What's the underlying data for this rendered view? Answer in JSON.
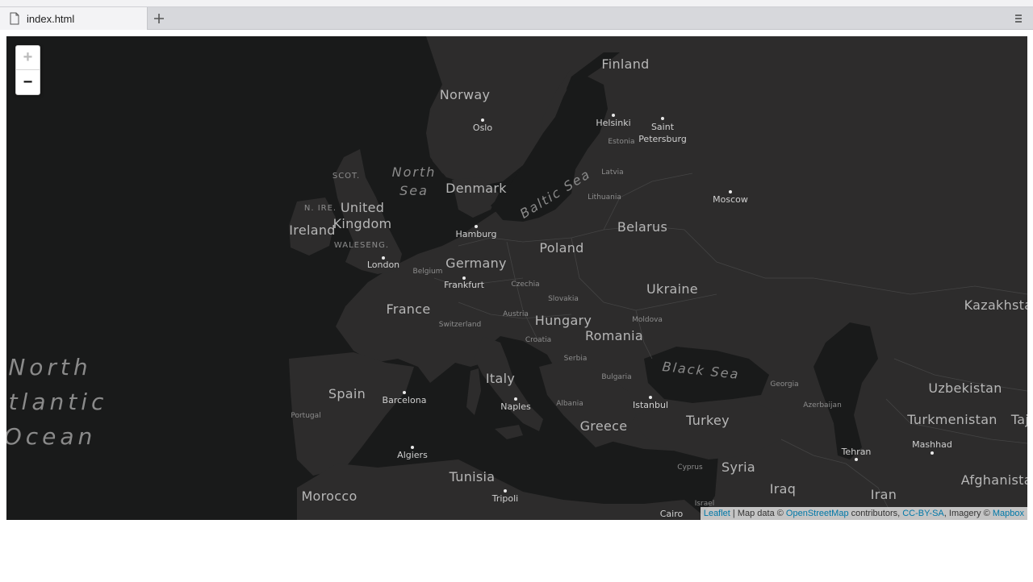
{
  "browser": {
    "tab_title": "index.html",
    "new_tab_icon": "plus-icon",
    "menu_icon": "hamburger-icon"
  },
  "map": {
    "zoom_in_label": "+",
    "zoom_out_label": "−",
    "colors": {
      "water": "#191a1a",
      "land": "#2d2c2c",
      "border": "#444444",
      "label": "#b7b7b7",
      "sea_label": "#8a8a8a",
      "accent_link": "#0078a8"
    },
    "country_labels": [
      {
        "id": "finland",
        "text": "Finland"
      },
      {
        "id": "norway",
        "text": "Norway"
      },
      {
        "id": "denmark",
        "text": "Denmark"
      },
      {
        "id": "united1",
        "text": "United"
      },
      {
        "id": "kingdom",
        "text": "Kingdom"
      },
      {
        "id": "ireland",
        "text": "Ireland"
      },
      {
        "id": "germany",
        "text": "Germany"
      },
      {
        "id": "poland",
        "text": "Poland"
      },
      {
        "id": "belarus",
        "text": "Belarus"
      },
      {
        "id": "ukraine",
        "text": "Ukraine"
      },
      {
        "id": "france",
        "text": "France"
      },
      {
        "id": "hungary",
        "text": "Hungary"
      },
      {
        "id": "romania",
        "text": "Romania"
      },
      {
        "id": "spain",
        "text": "Spain"
      },
      {
        "id": "italy",
        "text": "Italy"
      },
      {
        "id": "greece",
        "text": "Greece"
      },
      {
        "id": "turkey",
        "text": "Turkey"
      },
      {
        "id": "tunisia",
        "text": "Tunisia"
      },
      {
        "id": "morocco",
        "text": "Morocco"
      },
      {
        "id": "syria",
        "text": "Syria"
      },
      {
        "id": "iraq",
        "text": "Iraq"
      },
      {
        "id": "iran",
        "text": "Iran"
      },
      {
        "id": "kazakhstan",
        "text": "Kazakhsta"
      },
      {
        "id": "uzbekistan",
        "text": "Uzbekistan"
      },
      {
        "id": "turkmenistan",
        "text": "Turkmenistan"
      },
      {
        "id": "afghanistan",
        "text": "Afghanistan"
      },
      {
        "id": "taj",
        "text": "Taj"
      }
    ],
    "small_labels": [
      {
        "id": "scot",
        "text": "SCOT."
      },
      {
        "id": "nire",
        "text": "N. IRE."
      },
      {
        "id": "waleseng",
        "text": "WALESENG."
      },
      {
        "id": "estonia",
        "text": "Estonia"
      },
      {
        "id": "latvia",
        "text": "Latvia"
      },
      {
        "id": "lithuania",
        "text": "Lithuania"
      },
      {
        "id": "belgium",
        "text": "Belgium"
      },
      {
        "id": "czechia",
        "text": "Czechia"
      },
      {
        "id": "slovakia",
        "text": "Slovakia"
      },
      {
        "id": "austria",
        "text": "Austria"
      },
      {
        "id": "switzerland",
        "text": "Switzerland"
      },
      {
        "id": "croatia",
        "text": "Croatia"
      },
      {
        "id": "serbia",
        "text": "Serbia"
      },
      {
        "id": "moldova",
        "text": "Moldova"
      },
      {
        "id": "bulgaria",
        "text": "Bulgaria"
      },
      {
        "id": "albania",
        "text": "Albania"
      },
      {
        "id": "portugal",
        "text": "Portugal"
      },
      {
        "id": "georgia",
        "text": "Georgia"
      },
      {
        "id": "azerbaijan",
        "text": "Azerbaijan"
      },
      {
        "id": "cyprus",
        "text": "Cyprus"
      },
      {
        "id": "israel",
        "text": "Israel"
      }
    ],
    "sea_labels": [
      {
        "id": "north_sea_1",
        "text": "North"
      },
      {
        "id": "north_sea_2",
        "text": "Sea"
      },
      {
        "id": "baltic_sea",
        "text": "Baltic Sea"
      },
      {
        "id": "black_sea",
        "text": "Black Sea"
      },
      {
        "id": "atlantic_1",
        "text": "North"
      },
      {
        "id": "atlantic_2",
        "text": "tlantic"
      },
      {
        "id": "atlantic_3",
        "text": "Ocean"
      }
    ],
    "cities": [
      {
        "id": "oslo",
        "text": "Oslo"
      },
      {
        "id": "helsinki",
        "text": "Helsinki"
      },
      {
        "id": "saint",
        "text": "Saint"
      },
      {
        "id": "petersburg",
        "text": "Petersburg"
      },
      {
        "id": "moscow",
        "text": "Moscow"
      },
      {
        "id": "hamburg",
        "text": "Hamburg"
      },
      {
        "id": "london",
        "text": "London"
      },
      {
        "id": "frankfurt",
        "text": "Frankfurt"
      },
      {
        "id": "barcelona",
        "text": "Barcelona"
      },
      {
        "id": "naples",
        "text": "Naples"
      },
      {
        "id": "istanbul",
        "text": "Istanbul"
      },
      {
        "id": "algiers",
        "text": "Algiers"
      },
      {
        "id": "tripoli",
        "text": "Tripoli"
      },
      {
        "id": "cairo",
        "text": "Cairo"
      },
      {
        "id": "tehran",
        "text": "Tehran"
      },
      {
        "id": "mashhad",
        "text": "Mashhad"
      }
    ]
  },
  "attribution": {
    "leaflet": "Leaflet",
    "sep": " | Map data © ",
    "osm": "OpenStreetMap",
    "contributors": " contributors, ",
    "license": "CC-BY-SA",
    "imagery": ", Imagery © ",
    "mapbox": "Mapbox"
  }
}
